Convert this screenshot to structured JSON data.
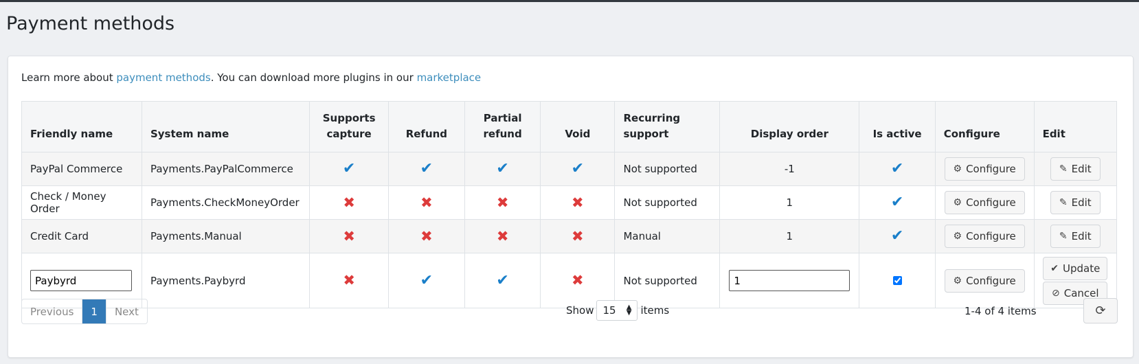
{
  "page": {
    "title": "Payment methods"
  },
  "intro": {
    "prefix": "Learn more about ",
    "link1": "payment methods",
    "middle": ". You can download more plugins in our ",
    "link2": "marketplace"
  },
  "table": {
    "columns": [
      "Friendly name",
      "System name",
      "Supports capture",
      "Refund",
      "Partial refund",
      "Void",
      "Recurring support",
      "Display order",
      "Is active",
      "Configure",
      "Edit"
    ],
    "rows": [
      {
        "friendly": "PayPal Commerce",
        "system": "Payments.PayPalCommerce",
        "capture": true,
        "refund": true,
        "partial": true,
        "void": true,
        "recurring": "Not supported",
        "order": "-1",
        "active": true
      },
      {
        "friendly": "Check / Money Order",
        "system": "Payments.CheckMoneyOrder",
        "capture": false,
        "refund": false,
        "partial": false,
        "void": false,
        "recurring": "Not supported",
        "order": "1",
        "active": true
      },
      {
        "friendly": "Credit Card",
        "system": "Payments.Manual",
        "capture": false,
        "refund": false,
        "partial": false,
        "void": false,
        "recurring": "Manual",
        "order": "1",
        "active": true
      }
    ],
    "edit_row": {
      "friendly": "Paybyrd",
      "system": "Payments.Paybyrd",
      "capture": false,
      "refund": true,
      "partial": true,
      "void": false,
      "recurring": "Not supported",
      "order": "1",
      "active": true
    },
    "configure_label": "Configure",
    "edit_label": "Edit",
    "update_label": "Update",
    "cancel_label": "Cancel"
  },
  "pager": {
    "previous": "Previous",
    "current": "1",
    "next": "Next"
  },
  "pagesize": {
    "show": "Show",
    "value": "15",
    "items": "items"
  },
  "count": "1-4 of 4 items",
  "icons": {
    "check": "check-icon",
    "cross": "cross-icon",
    "gear": "gear-icon",
    "pencil": "pencil-icon",
    "ban": "ban-icon",
    "refresh": "refresh-icon"
  },
  "colors": {
    "check": "#1a7fc9",
    "cross": "#dd3b3b",
    "link": "#3c8dbc",
    "active_page": "#337ab7"
  }
}
